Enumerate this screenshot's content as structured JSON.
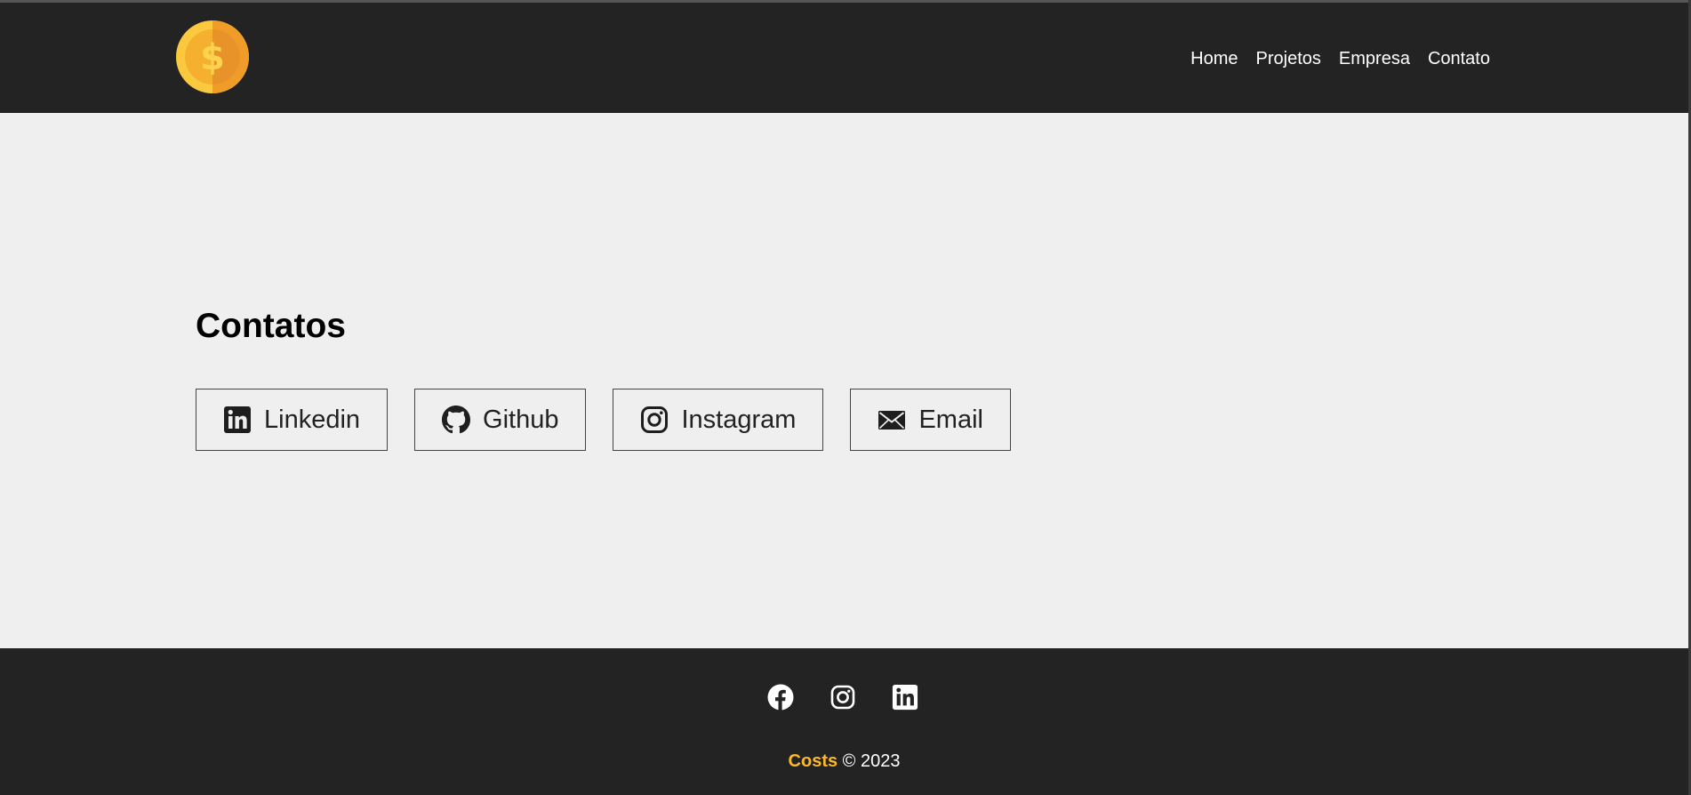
{
  "navbar": {
    "logo_icon": "dollar-coin-icon",
    "links": [
      {
        "label": "Home"
      },
      {
        "label": "Projetos"
      },
      {
        "label": "Empresa"
      },
      {
        "label": "Contato"
      }
    ]
  },
  "main": {
    "title": "Contatos",
    "contacts": [
      {
        "label": "Linkedin",
        "icon": "linkedin-icon"
      },
      {
        "label": "Github",
        "icon": "github-icon"
      },
      {
        "label": "Instagram",
        "icon": "instagram-icon"
      },
      {
        "label": "Email",
        "icon": "envelope-icon"
      }
    ]
  },
  "footer": {
    "social_icons": [
      "facebook-icon",
      "instagram-icon",
      "linkedin-icon"
    ],
    "brand": "Costs",
    "copyright": "© 2023"
  },
  "colors": {
    "background": "#efefef",
    "navbar": "#232323",
    "brand_accent": "#fbb929",
    "coin_light": "#fbc93d",
    "coin_dark": "#f09c28"
  }
}
